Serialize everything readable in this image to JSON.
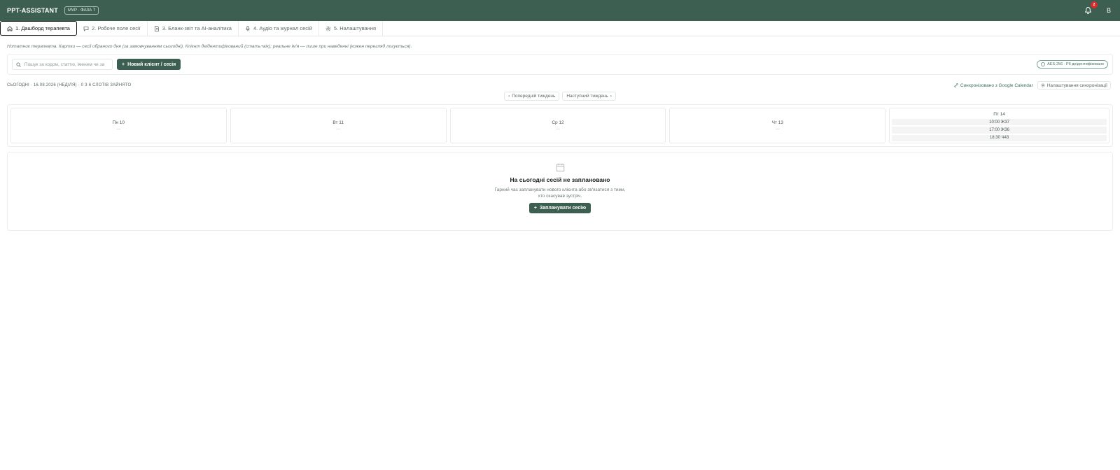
{
  "header": {
    "brand": "PPT-ASSISTANT",
    "phase_badge": "MVP · ФАЗА 7",
    "notifications_count": "2",
    "avatar_initial": "В",
    "bg_color": "#3d5f52"
  },
  "tabs": [
    {
      "label": "1. Дашборд терапевта",
      "icon": "home-icon",
      "active": true
    },
    {
      "label": "2. Робоче поле сесії",
      "icon": "chat-icon",
      "active": false
    },
    {
      "label": "3. Бланк-звіт та AI-аналітика",
      "icon": "document-icon",
      "active": false
    },
    {
      "label": "4. Аудіо та журнал сесій",
      "icon": "microphone-icon",
      "active": false
    },
    {
      "label": "5. Налаштування",
      "icon": "gear-icon",
      "active": false
    }
  ],
  "note": "Нотатник терапевта. Картки — сесії обраного дня (за замовчуванням сьогодні). Клієнт деідентифікований (стать+вік); реальне ім'я — лише при наведенні (кожен перегляд логується).",
  "toolbar": {
    "search_placeholder": "Пошук за кодом, статтю, іменем чи за",
    "new_client_label": "Новий клієнт / сесія",
    "pii_badge": "AES-256 · PII деідентифіковано"
  },
  "schedule": {
    "today_label": "СЬОГОДНІ · 16.08.2026 (НЕДІЛЯ) · 0 З 6 СЛОТІВ ЗАЙНЯТО",
    "sync_label": "Синхронізовано з Google Calendar",
    "sync_settings_label": "Налаштування синхронізації",
    "prev_week_label": "Попередній тиждень",
    "next_week_label": "Наступний тиждень",
    "days": [
      {
        "label": "Пн 10",
        "empty": "—"
      },
      {
        "label": "Вт 11",
        "empty": "—"
      },
      {
        "label": "Ср 12",
        "empty": "—"
      },
      {
        "label": "Чт 13",
        "empty": "—"
      },
      {
        "label": "Пт 14",
        "slots": [
          "10:00 Ж37",
          "17:00 Ж36",
          "18:30 Ч43"
        ]
      }
    ]
  },
  "empty_state": {
    "title": "На сьогодні сесій не заплановано",
    "text": "Гарний час запланувати нового клієнта або зв'язатися з тими, хто скасував зустріч.",
    "button_label": "Запланувати сесію"
  }
}
